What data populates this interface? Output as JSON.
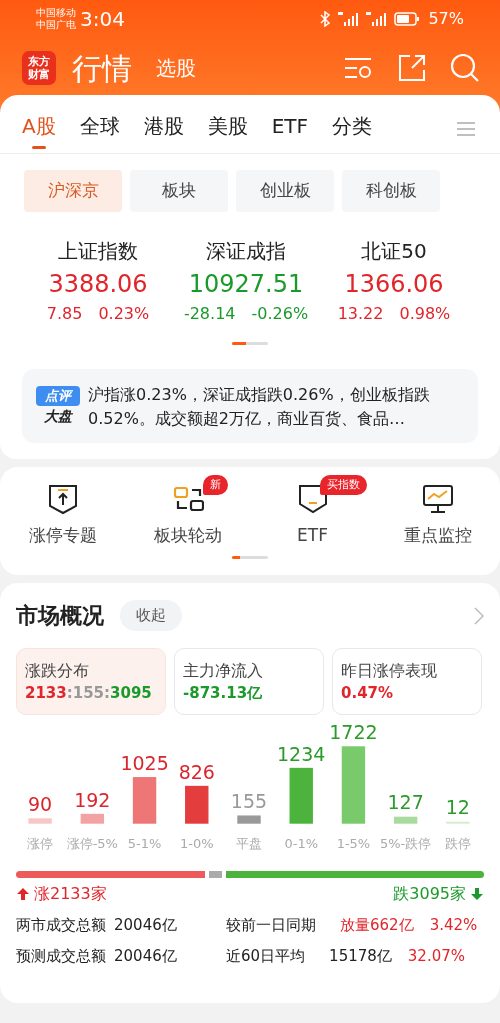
{
  "status_bar": {
    "carrier_1": "中国移动",
    "carrier_2": "中国广电",
    "time": "3:04",
    "battery": "57%"
  },
  "app_bar": {
    "logo_lines": [
      "东方",
      "财富"
    ],
    "title": "行情",
    "secondary": "选股"
  },
  "tabs": [
    {
      "label": "A股",
      "selected": true
    },
    {
      "label": "全球",
      "selected": false
    },
    {
      "label": "港股",
      "selected": false
    },
    {
      "label": "美股",
      "selected": false
    },
    {
      "label": "ETF",
      "selected": false
    },
    {
      "label": "分类",
      "selected": false
    }
  ],
  "sub_tabs": [
    {
      "label": "沪深京",
      "selected": true
    },
    {
      "label": "板块",
      "selected": false
    },
    {
      "label": "创业板",
      "selected": false
    },
    {
      "label": "科创板",
      "selected": false
    }
  ],
  "indices": [
    {
      "name": "上证指数",
      "value": "3388.06",
      "change": "7.85",
      "percent": "0.23%",
      "color": "#e0252b"
    },
    {
      "name": "深证成指",
      "value": "10927.51",
      "change": "-28.14",
      "percent": "-0.26%",
      "color": "#1a9a2a"
    },
    {
      "name": "北证50",
      "value": "1366.06",
      "change": "13.22",
      "percent": "0.98%",
      "color": "#e0252b"
    }
  ],
  "commentary": {
    "badge_top": "点评",
    "badge_bottom": "大盘",
    "text": "沪指涨0.23%，深证成指跌0.26%，创业板指跌0.52%。成交额超2万亿，商业百货、食品…"
  },
  "shortcuts": [
    {
      "kind": "limit-up",
      "label": "涨停专题"
    },
    {
      "kind": "rotation",
      "label": "板块轮动",
      "badge": "新"
    },
    {
      "kind": "etf",
      "label": "ETF",
      "badge": "买指数"
    },
    {
      "kind": "monitor",
      "label": "重点监控"
    }
  ],
  "market": {
    "title": "市场概况",
    "collapse": "收起",
    "stats": [
      {
        "label": "涨跌分布",
        "selected": true,
        "value_parts": [
          {
            "text": "2133",
            "color": "#e0252b"
          },
          {
            "text": ":155:",
            "color": "#999999"
          },
          {
            "text": "3095",
            "color": "#1a9a2a"
          }
        ]
      },
      {
        "label": "主力净流入",
        "selected": false,
        "value_parts": [
          {
            "text": "-873.13亿",
            "color": "#1a9a2a"
          }
        ]
      },
      {
        "label": "昨日涨停表现",
        "selected": false,
        "value_parts": [
          {
            "text": "0.47%",
            "color": "#e0252b"
          }
        ]
      }
    ],
    "distribution": {
      "bars": [
        {
          "color": "#f8c6c6"
        },
        {
          "color": "#f2a2a2"
        },
        {
          "color": "#ee7676"
        },
        {
          "color": "#e33d3d"
        },
        {
          "color": "#999999"
        },
        {
          "color": "#4cb43c"
        },
        {
          "color": "#79ca6b"
        },
        {
          "color": "#a8db9d"
        },
        {
          "color": "#d4ecce"
        }
      ],
      "chart_data": {
        "type": "bar",
        "categories": [
          "涨停",
          "涨停-5%",
          "5-1%",
          "1-0%",
          "平盘",
          "0-1%",
          "1-5%",
          "5%-跌停",
          "跌停"
        ],
        "values": [
          90,
          192,
          1025,
          826,
          155,
          1234,
          1722,
          127,
          12
        ],
        "data_labels": true
      }
    },
    "breadth": {
      "up_label": "涨2133家",
      "down_label": "跌3095家"
    },
    "turnover": [
      {
        "label": "两市成交总额",
        "value": "20046亿",
        "compare_label": "较前一日同期",
        "compare_parts": [
          {
            "text": "放量662亿",
            "color": "#e0252b"
          },
          {
            "text": "3.42%",
            "color": "#e0252b"
          }
        ]
      },
      {
        "label": "预测成交总额",
        "value": "20046亿",
        "compare_label": "近60日平均",
        "compare_parts": [
          {
            "text": "15178亿",
            "color": "#222222"
          },
          {
            "text": "32.07%",
            "color": "#e0252b"
          }
        ]
      }
    ]
  }
}
